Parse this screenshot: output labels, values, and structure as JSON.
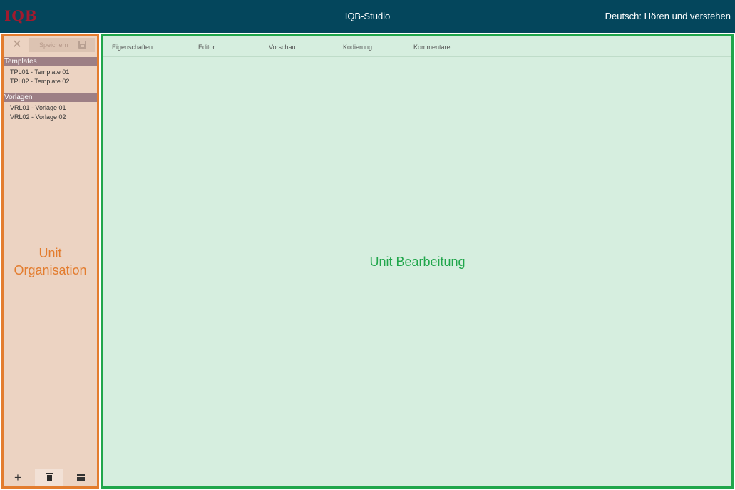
{
  "header": {
    "logo_text": "IQB",
    "app_title": "IQB-Studio",
    "context_label": "Deutsch: Hören und verstehen"
  },
  "left_panel": {
    "toolbar": {
      "close_icon": "close-icon",
      "save_label": "Speichern",
      "save_icon": "save-icon"
    },
    "groups": [
      {
        "title": "Templates",
        "items": [
          "TPL01 - Template 01",
          "TPL02 - Template 02"
        ]
      },
      {
        "title": "Vorlagen",
        "items": [
          "VRL01 - Vorlage 01",
          "VRL02 - Vorlage 02"
        ]
      }
    ],
    "region_label": "Unit Organisation",
    "footer": {
      "add_label": "+",
      "delete_icon": "trash-icon",
      "menu_icon": "menu-icon"
    }
  },
  "right_panel": {
    "tabs": [
      "Eigenschaften",
      "Editor",
      "Vorschau",
      "Kodierung",
      "Kommentare"
    ],
    "region_label": "Unit Bearbeitung"
  },
  "colors": {
    "header_bg": "#04465c",
    "logo": "#a11a2e",
    "left_bg": "#ecd3c2",
    "left_border": "#e37c2e",
    "right_bg": "#d6eedf",
    "right_border": "#20a64b",
    "group_header_bg": "#9d7f85"
  }
}
